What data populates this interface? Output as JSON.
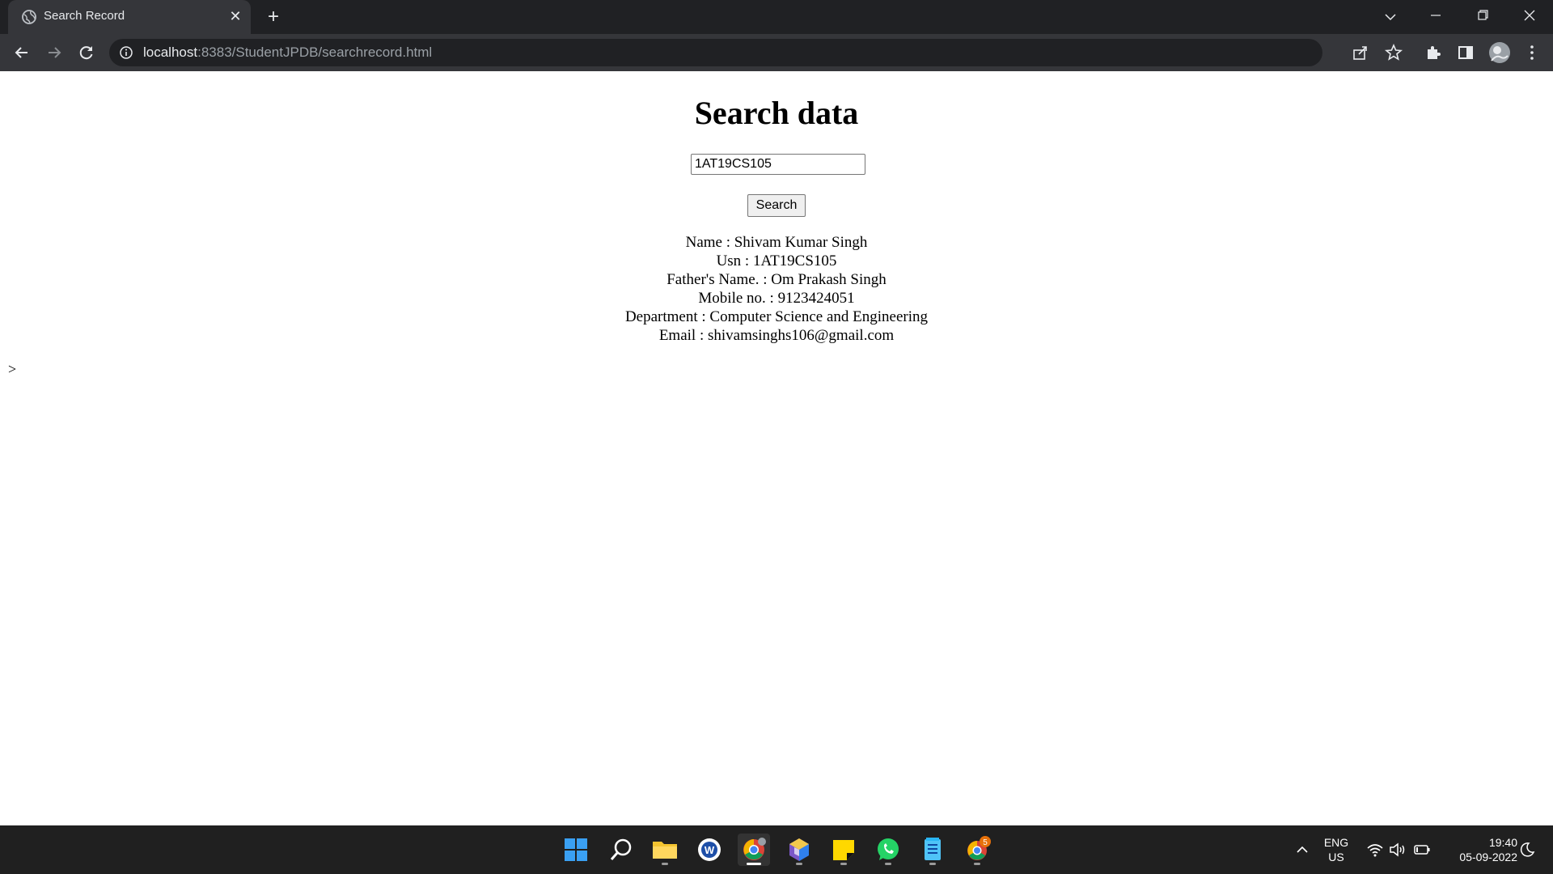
{
  "browser": {
    "tab_title": "Search Record",
    "url_host": "localhost",
    "url_rest": ":8383/StudentJPDB/searchrecord.html"
  },
  "page": {
    "heading": "Search data",
    "search_value": "1AT19CS105",
    "search_button_label": "Search",
    "record": {
      "name": "Name : Shivam Kumar Singh",
      "usn": "Usn : 1AT19CS105",
      "father": "Father's Name. : Om Prakash Singh",
      "mobile": "Mobile no. : 9123424051",
      "department": "Department : Computer Science and Engineering",
      "email": "Email : shivamsinghs106@gmail.com"
    },
    "stray_text": ">"
  },
  "taskbar": {
    "language": "ENG",
    "region": "US",
    "time": "19:40",
    "date": "05-09-2022",
    "chrome_badge": "5"
  }
}
